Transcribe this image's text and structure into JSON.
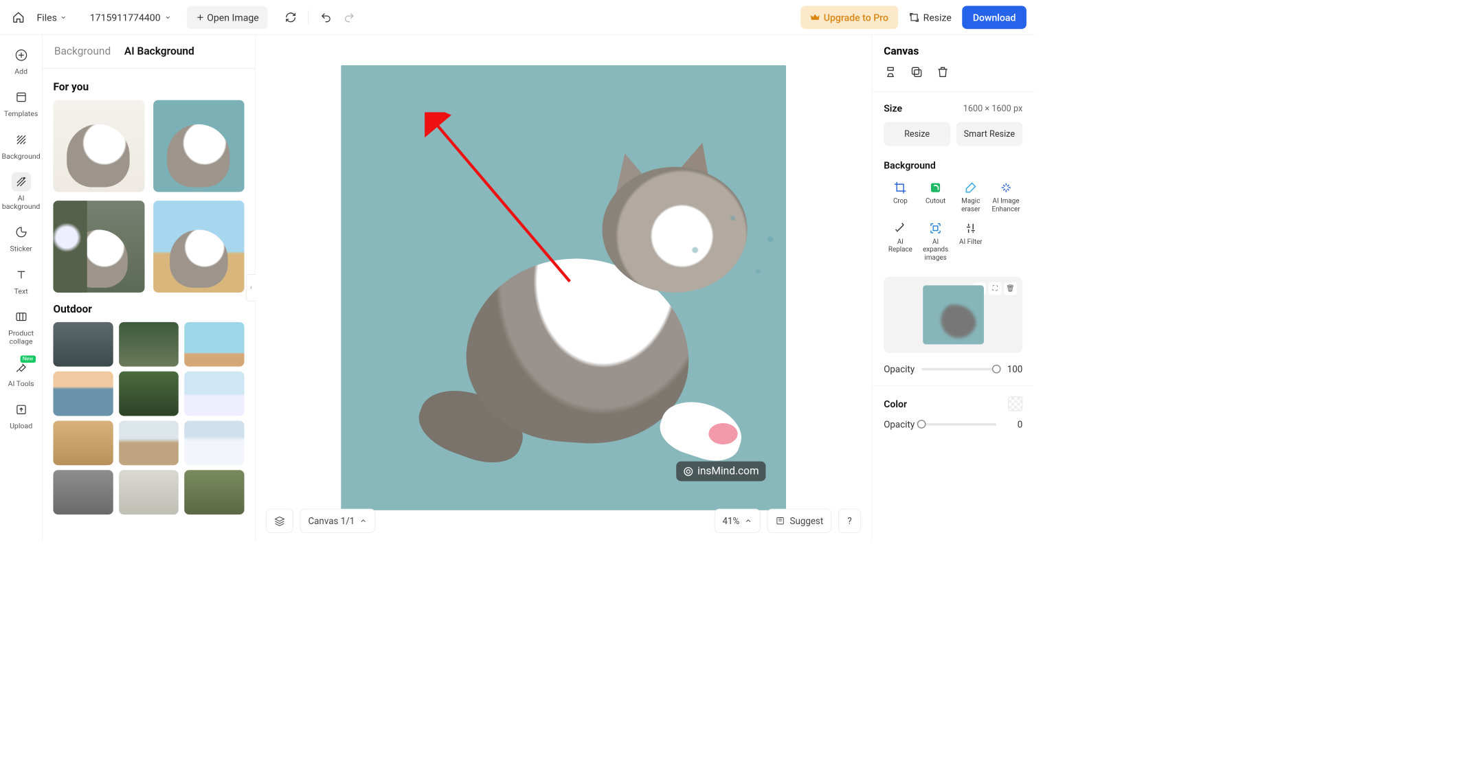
{
  "top": {
    "files": "Files",
    "project": "1715911774400",
    "open_image": "Open Image",
    "upgrade": "Upgrade to Pro",
    "resize": "Resize",
    "download": "Download"
  },
  "rail": {
    "add": "Add",
    "templates": "Templates",
    "background": "Background",
    "ai_background": "AI\nbackground",
    "sticker": "Sticker",
    "text": "Text",
    "product_collage": "Product\ncollage",
    "ai_tools": "AI Tools",
    "upload": "Upload",
    "new": "New"
  },
  "panel": {
    "tab_bg": "Background",
    "tab_ai": "AI Background",
    "for_you": "For you",
    "outdoor": "Outdoor"
  },
  "bottom": {
    "canvas": "Canvas 1/1",
    "zoom": "41%",
    "suggest": "Suggest",
    "help": "?"
  },
  "right": {
    "canvas": "Canvas",
    "size": "Size",
    "dims": "1600 × 1600 px",
    "resize": "Resize",
    "smart_resize": "Smart Resize",
    "background": "Background",
    "tools": {
      "crop": "Crop",
      "cutout": "Cutout",
      "magic": "Magic\neraser",
      "enhancer": "AI Image\nEnhancer",
      "replace": "AI\nReplace",
      "expand": "AI\nexpands\nimages",
      "filter": "AI Filter"
    },
    "opacity": "Opacity",
    "opacity_val": "100",
    "color": "Color",
    "color_opacity_val": "0"
  },
  "watermark": "insMind.com"
}
